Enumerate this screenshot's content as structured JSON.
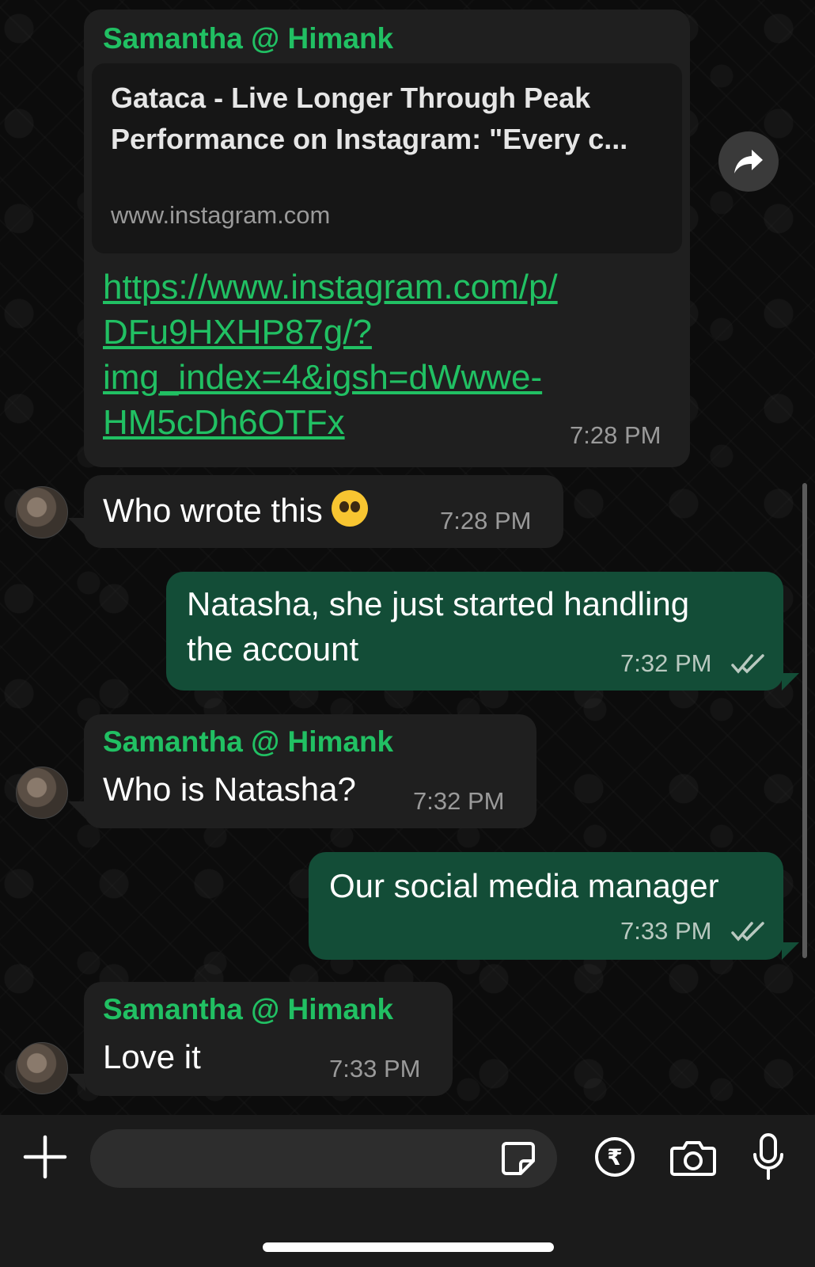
{
  "colors": {
    "accent_green": "#21c063",
    "incoming_bubble": "#1f1f1f",
    "outgoing_bubble": "#134d37",
    "background": "#0c0c0c"
  },
  "messages": [
    {
      "direction": "incoming",
      "sender": "Samantha @ Himank",
      "preview": {
        "title": "Gataca - Live Longer Through Peak Performance on Instagram: \"Every c...",
        "domain": "www.instagram.com"
      },
      "link_lines": [
        "https://www.instagram.com/p/",
        "DFu9HXHP87g/?",
        "img_index=4&igsh=dWwwe-",
        "HM5cDh6OTFx"
      ],
      "time": "7:28 PM"
    },
    {
      "direction": "incoming",
      "text": "Who wrote this",
      "emoji": "pleading-face",
      "time": "7:28 PM"
    },
    {
      "direction": "outgoing",
      "lines": [
        "Natasha, she just started handling",
        "the account"
      ],
      "time": "7:32 PM",
      "status": "read"
    },
    {
      "direction": "incoming",
      "sender": "Samantha @ Himank",
      "text": "Who is Natasha?",
      "time": "7:32 PM"
    },
    {
      "direction": "outgoing",
      "text": "Our social media manager",
      "time": "7:33 PM",
      "status": "read"
    },
    {
      "direction": "incoming",
      "sender": "Samantha @ Himank",
      "text": "Love it",
      "time": "7:33 PM"
    }
  ],
  "input_bar": {
    "placeholder": "",
    "icons": [
      "plus-icon",
      "sticker-icon",
      "rupee-payment-icon",
      "camera-icon",
      "microphone-icon"
    ]
  }
}
